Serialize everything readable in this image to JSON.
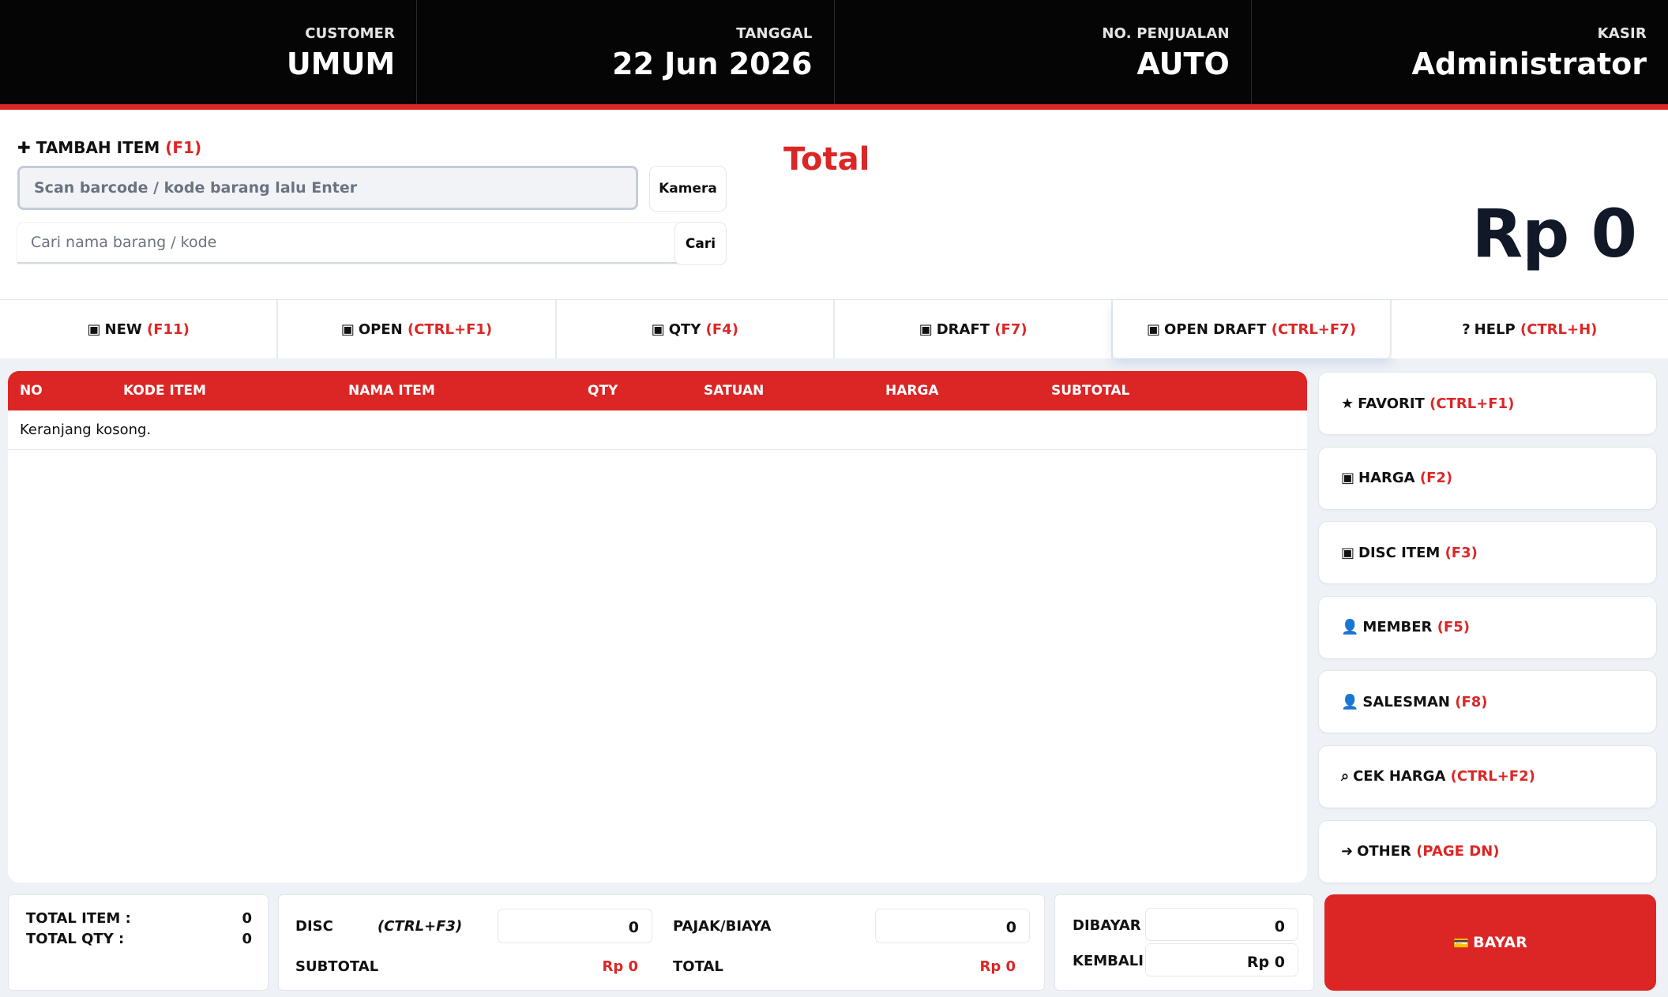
{
  "header": {
    "customer": {
      "label": "CUSTOMER",
      "value": "UMUM"
    },
    "tanggal": {
      "label": "TANGGAL",
      "value": "22 Jun 2026"
    },
    "no_penjualan": {
      "label": "NO. PENJUALAN",
      "value": "AUTO"
    },
    "kasir": {
      "label": "KASIR",
      "value": "Administrator"
    }
  },
  "add_item": {
    "icon": "✚",
    "title": "TAMBAH ITEM",
    "shortcut": "(F1)",
    "scan_placeholder": "Scan barcode / kode barang lalu Enter",
    "camera_label": "Kamera",
    "search_placeholder": "Cari nama barang / kode",
    "search_label": "Cari"
  },
  "total": {
    "label": "Total",
    "value": "Rp 0"
  },
  "toolbar": [
    {
      "icon": "▣",
      "label": "NEW",
      "shortcut": "(F11)"
    },
    {
      "icon": "▣",
      "label": "OPEN",
      "shortcut": "(CTRL+F1)"
    },
    {
      "icon": "▣",
      "label": "QTY",
      "shortcut": "(F4)"
    },
    {
      "icon": "▣",
      "label": "DRAFT",
      "shortcut": "(F7)"
    },
    {
      "icon": "▣",
      "label": "OPEN DRAFT",
      "shortcut": "(CTRL+F7)"
    },
    {
      "icon": "?",
      "label": "HELP",
      "shortcut": "(CTRL+H)"
    }
  ],
  "table": {
    "columns": [
      "NO",
      "KODE ITEM",
      "NAMA ITEM",
      "QTY",
      "SATUAN",
      "HARGA",
      "SUBTOTAL"
    ],
    "empty_text": "Keranjang kosong."
  },
  "side_buttons": [
    {
      "icon": "★",
      "label": "FAVORIT",
      "shortcut": "(CTRL+F1)"
    },
    {
      "icon": "▣",
      "label": "HARGA",
      "shortcut": "(F2)"
    },
    {
      "icon": "▣",
      "label": "DISC ITEM",
      "shortcut": "(F3)"
    },
    {
      "icon": "👤",
      "label": "MEMBER",
      "shortcut": "(F5)"
    },
    {
      "icon": "👤",
      "label": "SALESMAN",
      "shortcut": "(F8)"
    },
    {
      "icon": "⌕",
      "label": "CEK HARGA",
      "shortcut": "(CTRL+F2)"
    },
    {
      "icon": "➜",
      "label": "OTHER",
      "shortcut": "(PAGE DN)"
    }
  ],
  "summary": {
    "total_item_label": "TOTAL ITEM :",
    "total_item_value": "0",
    "total_qty_label": "TOTAL QTY :",
    "total_qty_value": "0",
    "disc_label": "DISC",
    "disc_shortcut": "(CTRL+F3)",
    "disc_value": "0",
    "pajak_label": "PAJAK/BIAYA",
    "pajak_value": "0",
    "subtotal_label": "SUBTOTAL",
    "subtotal_value": "Rp 0",
    "total_label": "TOTAL",
    "total_value": "Rp 0",
    "dibayar_label": "DIBAYAR",
    "dibayar_value": "0",
    "kembali_label": "KEMBALI",
    "kembali_value": "Rp 0"
  },
  "pay": {
    "icon": "💳",
    "label": "BAYAR"
  },
  "colors": {
    "accent": "#dc2626",
    "header_bg": "#050505"
  }
}
